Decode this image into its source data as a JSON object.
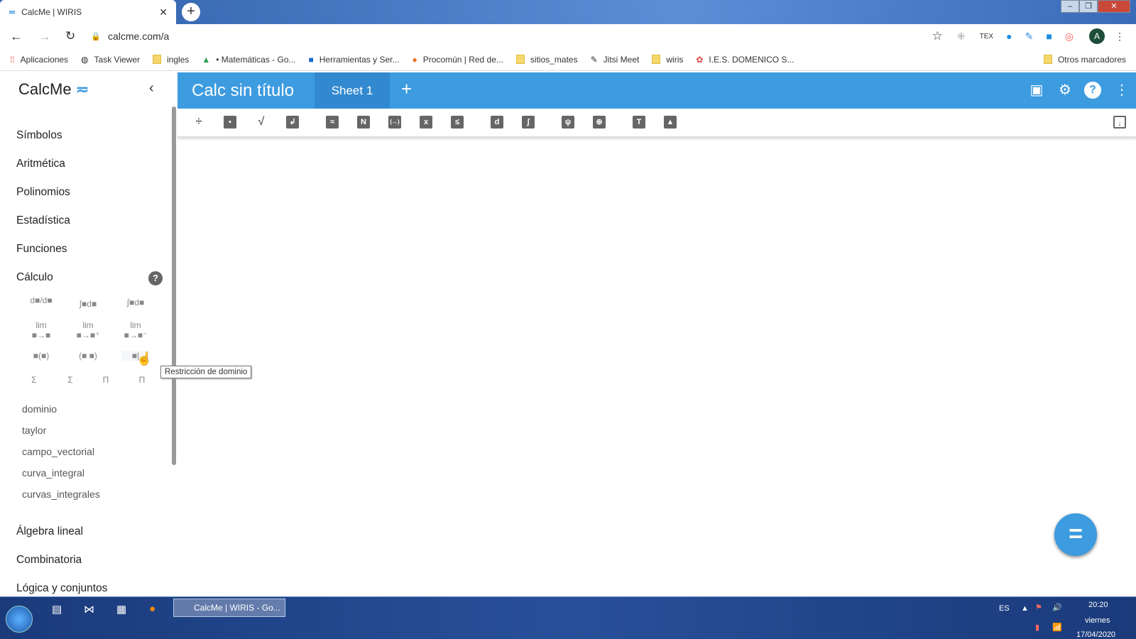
{
  "browser": {
    "tab_title": "CalcMe | WIRIS",
    "url": "calcme.com/a",
    "avatar": "A",
    "bookmarks": [
      "Aplicaciones",
      "Task Viewer",
      "ingles",
      "• Matemáticas - Go...",
      "Herramientas y Ser...",
      "Procomún | Red de...",
      "sitios_mates",
      "Jitsi Meet",
      "wiris",
      "I.E.S. DOMENICO S..."
    ],
    "other_bookmarks": "Otros marcadores",
    "ext_tex": "TEX"
  },
  "app": {
    "logo": "CalcMe",
    "title": "Calc sin título",
    "sheet_tab": "Sheet 1",
    "add_sheet": "+",
    "fab": "="
  },
  "sidebar": {
    "categories": [
      "Símbolos",
      "Aritmética",
      "Polinomios",
      "Estadística",
      "Funciones",
      "Cálculo"
    ],
    "calc_icons": [
      "d■/d■",
      "∫■d■",
      "∫■d■",
      "lim ■→■",
      "lim ■→■⁺",
      "lim ■→■⁻",
      "■(■)",
      "(■ ■)",
      "■|",
      "Σ",
      "Σ",
      "Π",
      "Π"
    ],
    "commands": [
      "dominio",
      "taylor",
      "campo_vectorial",
      "curva_integral",
      "curvas_integrales"
    ],
    "more_categories": [
      "Álgebra lineal",
      "Combinatoria",
      "Lógica y conjuntos"
    ]
  },
  "toolbar": {
    "icons": [
      "fraction",
      "power",
      "sqrt",
      "subscript",
      "approx",
      "evaluate",
      "interval",
      "solve",
      "inequality",
      "d",
      "∫",
      "graph",
      "table",
      "T",
      "image"
    ]
  },
  "tooltip": "Restricción de dominio",
  "taskbar": {
    "chrome_label": "CalcMe | WIRIS - Go...",
    "lang": "ES",
    "time": "20:20",
    "day": "viernes",
    "date": "17/04/2020"
  }
}
